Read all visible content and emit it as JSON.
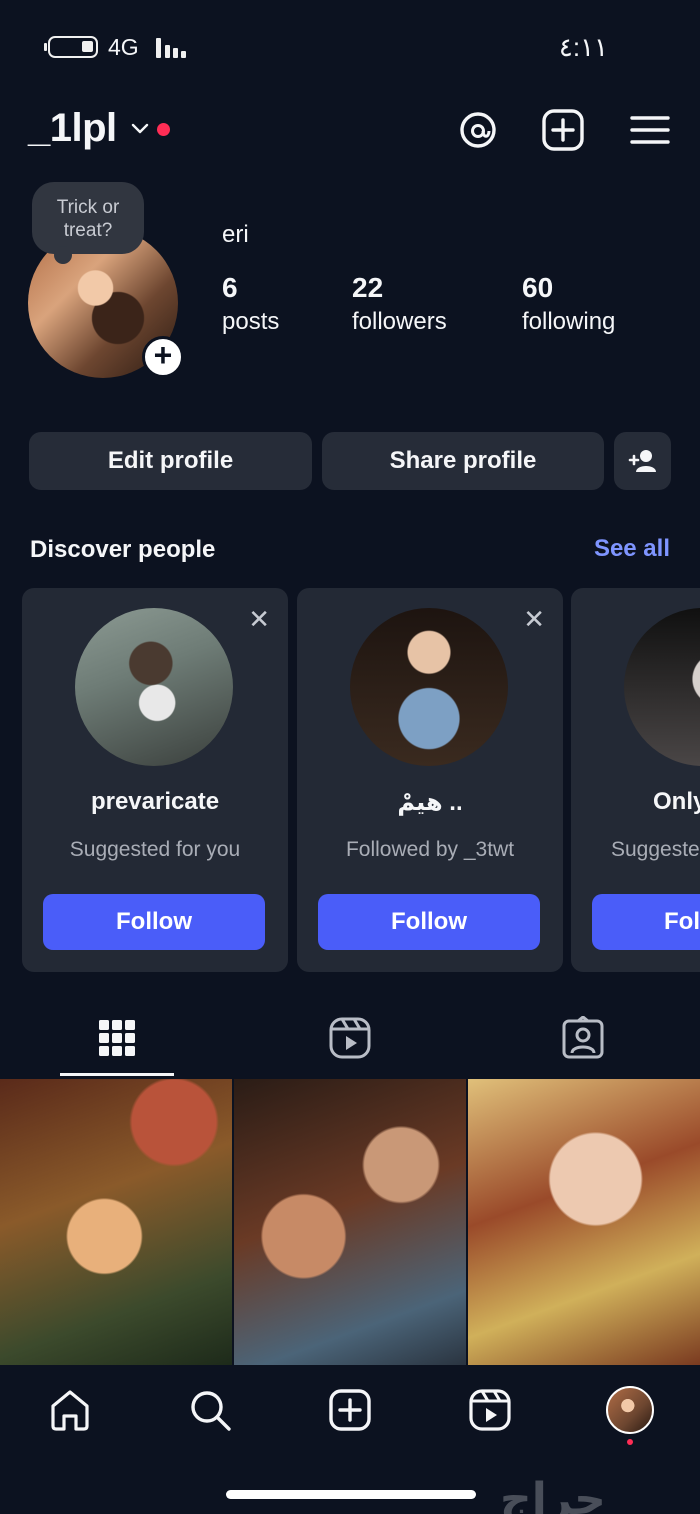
{
  "status_bar": {
    "network": "4G",
    "time": "٤:١١"
  },
  "header": {
    "username": "_1lpl"
  },
  "profile": {
    "note": "Trick or treat?",
    "full_name": "eri",
    "stats": [
      {
        "value": "6",
        "label": "posts"
      },
      {
        "value": "22",
        "label": "followers"
      },
      {
        "value": "60",
        "label": "following"
      }
    ]
  },
  "actions": {
    "edit": "Edit profile",
    "share": "Share profile"
  },
  "discover": {
    "title": "Discover people",
    "see_all": "See all",
    "cards": [
      {
        "name": "prevaricate",
        "subtitle": "Suggested for you",
        "button": "Follow"
      },
      {
        "name": "هيمْ ..",
        "subtitle": "Followed by _3twt",
        "button": "Follow"
      },
      {
        "name": "Only",
        "subtitle": "Suggeste",
        "button": "Fol"
      }
    ]
  },
  "colors": {
    "background": "#0c1220",
    "accent": "#4a5df9",
    "link": "#7f95ff",
    "notification": "#ff2d55"
  },
  "watermark": "حراج"
}
